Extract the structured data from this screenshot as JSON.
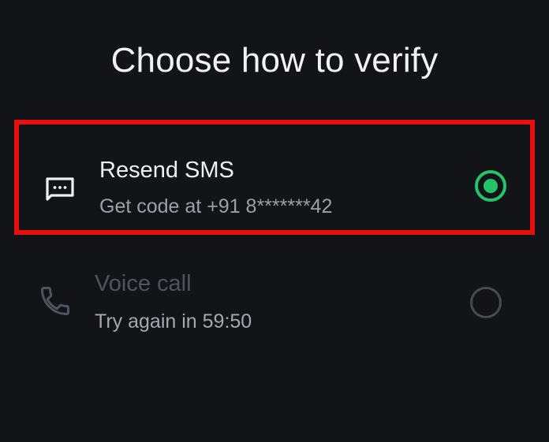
{
  "title": "Choose how to verify",
  "options": [
    {
      "label": "Resend SMS",
      "sublabel": "Get code at +91 8*******42",
      "icon": "sms-message-icon",
      "selected": true,
      "enabled": true
    },
    {
      "label": "Voice call",
      "sublabel": "Try again in 59:50",
      "icon": "phone-icon",
      "selected": false,
      "enabled": false
    }
  ],
  "colors": {
    "background": "#121417",
    "accent": "#25c46a",
    "highlight_border": "#e80f0f",
    "disabled_text": "#4d5560"
  }
}
